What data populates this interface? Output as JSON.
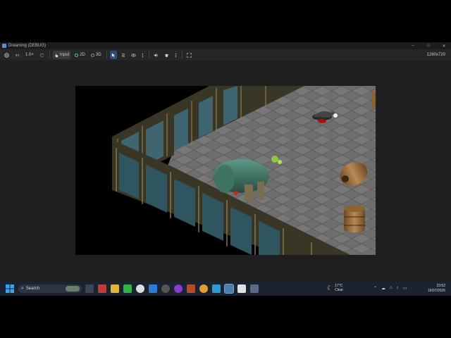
{
  "window": {
    "title": "Dreaming (DEBUG)",
    "controls": [
      "–",
      "□",
      "✕"
    ]
  },
  "toolbar": {
    "speed_label": "1.0×",
    "input_label": "Input",
    "mode_2d_label": "2D",
    "mode_3d_label": "3D",
    "resolution": "1280x720"
  },
  "game": {
    "description_icons": [
      "steel-wall-icon",
      "metal-tank-icon",
      "barrel-icon",
      "ghoul-creature-icon"
    ]
  },
  "taskbar": {
    "search_placeholder": "Search",
    "weather_temp": "17°C",
    "weather_desc": "Clear",
    "time": "23:52",
    "date": "16/07/2026"
  },
  "colors": {
    "taskbar_bg": "#1b2330",
    "toolbar_bg": "#262626",
    "accent": "#2f4d78"
  }
}
